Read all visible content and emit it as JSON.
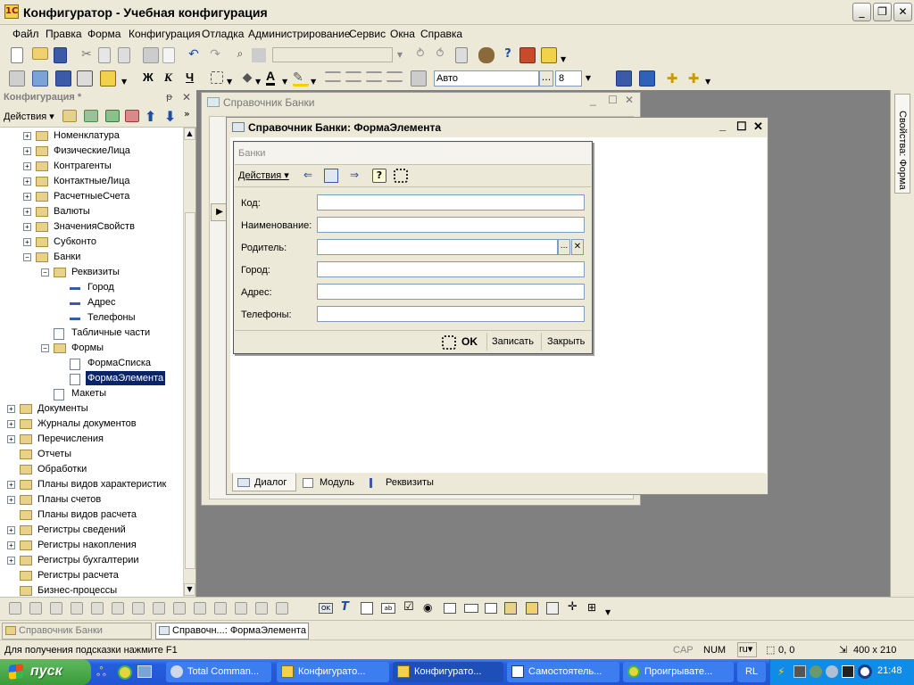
{
  "app": {
    "title": "Конфигуратор - Учебная конфигурация",
    "icon_label": "1С"
  },
  "window_buttons": {
    "minimize": "_",
    "restore": "❐",
    "close": "✕"
  },
  "menu": [
    "Файл",
    "Правка",
    "Форма",
    "Конфигурация",
    "Отладка",
    "Администрирование",
    "Сервис",
    "Окна",
    "Справка"
  ],
  "format_toolbar": {
    "bold": "Ж",
    "italic": "К",
    "underline": "Ч",
    "font_name": "Авто",
    "font_size": "8",
    "font_more": "..."
  },
  "left_panel": {
    "title": "Конфигурация *",
    "pin": "ᵽ",
    "close": "✕",
    "actions_label": "Действия",
    "tree": [
      {
        "label": "Номенклатура",
        "level": 1,
        "expander": "+"
      },
      {
        "label": "ФизическиеЛица",
        "level": 1,
        "expander": "+"
      },
      {
        "label": "Контрагенты",
        "level": 1,
        "expander": "+"
      },
      {
        "label": "КонтактныеЛица",
        "level": 1,
        "expander": "+"
      },
      {
        "label": "РасчетныеСчета",
        "level": 1,
        "expander": "+"
      },
      {
        "label": "Валюты",
        "level": 1,
        "expander": "+"
      },
      {
        "label": "ЗначенияСвойств",
        "level": 1,
        "expander": "+"
      },
      {
        "label": "Субконто",
        "level": 1,
        "expander": "+"
      },
      {
        "label": "Банки",
        "level": 1,
        "expander": "−"
      },
      {
        "label": "Реквизиты",
        "level": 2,
        "expander": "−"
      },
      {
        "label": "Город",
        "level": 3,
        "expander": ""
      },
      {
        "label": "Адрес",
        "level": 3,
        "expander": ""
      },
      {
        "label": "Телефоны",
        "level": 3,
        "expander": ""
      },
      {
        "label": "Табличные части",
        "level": 2,
        "expander": ""
      },
      {
        "label": "Формы",
        "level": 2,
        "expander": "−"
      },
      {
        "label": "ФормаСписка",
        "level": 3,
        "expander": ""
      },
      {
        "label": "ФормаЭлемента",
        "level": 3,
        "expander": "",
        "selected": true
      },
      {
        "label": "Макеты",
        "level": 2,
        "expander": ""
      },
      {
        "label": "Документы",
        "level": 0,
        "expander": "+"
      },
      {
        "label": "Журналы документов",
        "level": 0,
        "expander": "+"
      },
      {
        "label": "Перечисления",
        "level": 0,
        "expander": "+"
      },
      {
        "label": "Отчеты",
        "level": 0,
        "expander": ""
      },
      {
        "label": "Обработки",
        "level": 0,
        "expander": ""
      },
      {
        "label": "Планы видов характеристик",
        "level": 0,
        "expander": "+"
      },
      {
        "label": "Планы счетов",
        "level": 0,
        "expander": "+"
      },
      {
        "label": "Планы видов расчета",
        "level": 0,
        "expander": ""
      },
      {
        "label": "Регистры сведений",
        "level": 0,
        "expander": "+"
      },
      {
        "label": "Регистры накопления",
        "level": 0,
        "expander": "+"
      },
      {
        "label": "Регистры бухгалтерии",
        "level": 0,
        "expander": "+"
      },
      {
        "label": "Регистры расчета",
        "level": 0,
        "expander": ""
      },
      {
        "label": "Бизнес-процессы",
        "level": 0,
        "expander": ""
      }
    ]
  },
  "list_window": {
    "title": "Справочник Банки"
  },
  "form_window": {
    "title": "Справочник Банки: ФормаЭлемента",
    "form_caption": "Банки",
    "actions_label": "Действия",
    "help_icon": "?",
    "fields": [
      {
        "label": "Код:"
      },
      {
        "label": "Наименование:"
      },
      {
        "label": "Родитель:",
        "buttons": [
          "...",
          "✕"
        ]
      },
      {
        "label": "Город:"
      },
      {
        "label": "Адрес:"
      },
      {
        "label": "Телефоны:"
      }
    ],
    "ok_label": "OK",
    "save_label": "Записать",
    "close_label": "Закрыть",
    "tabs": [
      "Диалог",
      "Модуль",
      "Реквизиты"
    ]
  },
  "right_panel_label": "Свойства: Форма",
  "window_tabs": [
    "Справочник Банки",
    "Справочн...: ФормаЭлемента"
  ],
  "status_bar": {
    "hint": "Для получения подсказки нажмите F1",
    "cap": "CAP",
    "num": "NUM",
    "lang": "ru",
    "pos": "0, 0",
    "size": "400 x 210"
  },
  "taskbar": {
    "start": "пуск",
    "tasks": [
      "Total Comman...",
      "Конфигурато...",
      "Конфигурато...",
      "Самостоятель...",
      "Проигрывате..."
    ],
    "lang": "RL",
    "time": "21:48"
  },
  "colors": {
    "selection": "#0a246a",
    "taskbar": "#245edb",
    "start": "#3a9b3a",
    "workspace": "#808080"
  }
}
